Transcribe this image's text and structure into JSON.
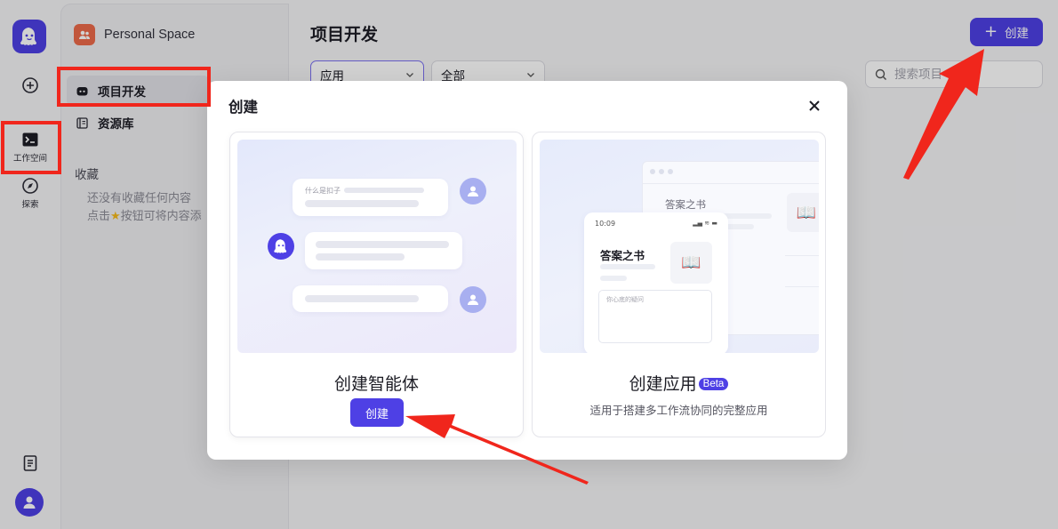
{
  "rail": {
    "workspace_label": "工作空间",
    "explore_label": "探索"
  },
  "sidebar": {
    "space_name": "Personal Space",
    "nav": [
      {
        "label": "项目开发",
        "icon": "bot-icon",
        "active": true
      },
      {
        "label": "资源库",
        "icon": "library-icon",
        "active": false
      }
    ],
    "favorites_title": "收藏",
    "favorites_empty_line1": "还没有收藏任何内容",
    "favorites_empty_line2_prefix": "点击",
    "favorites_empty_line2_suffix": "按钮可将内容添"
  },
  "main": {
    "title": "项目开发",
    "create_label": "创建",
    "filter_type": "应用",
    "filter_scope": "全部",
    "search_placeholder": "搜索项目"
  },
  "modal": {
    "title": "创建",
    "cards": [
      {
        "title": "创建智能体",
        "button": "创建",
        "bubble_text": "什么是扣子"
      },
      {
        "title": "创建应用",
        "badge": "Beta",
        "description": "适用于搭建多工作流协同的完整应用",
        "phone_time": "10:09",
        "app_name": "答案之书",
        "app_name_back": "答案之书",
        "input_hint": "你心底的疑问"
      }
    ]
  },
  "colors": {
    "accent": "#4e40e5",
    "annotation_red": "#f0261c",
    "space_icon": "#ec6a4a"
  }
}
